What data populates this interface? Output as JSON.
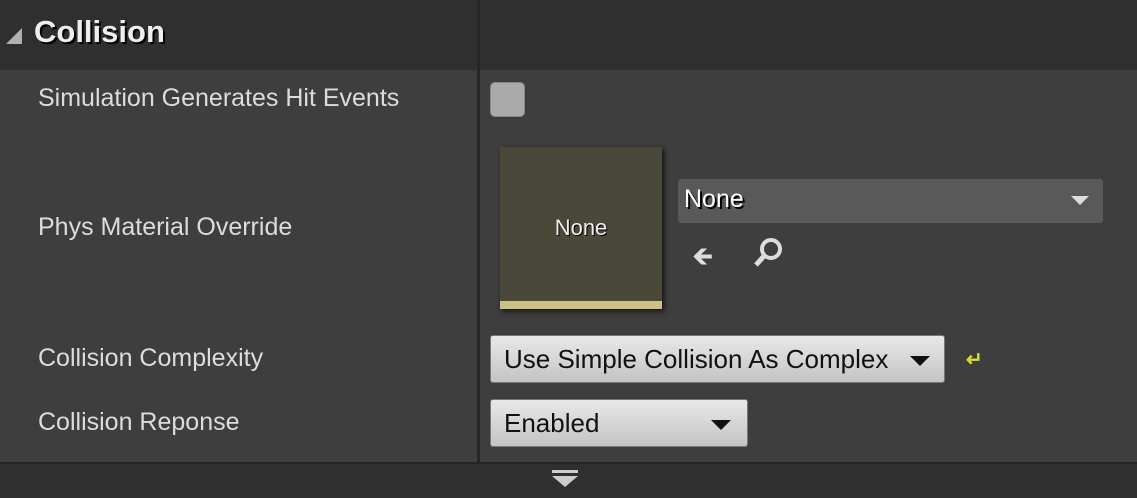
{
  "section": {
    "title": "Collision",
    "expand_icon": "triangle-down-icon"
  },
  "properties": [
    {
      "label": "Simulation Generates Hit Events",
      "checked": false
    },
    {
      "label": "Phys Material Override",
      "thumbnail_text": "None",
      "value": "None",
      "icons": [
        "use-selected-arrow-icon",
        "browse-magnifier-icon"
      ]
    },
    {
      "label": "Collision Complexity",
      "value": "Use Simple Collision As Complex",
      "reset_icon": "reset-to-default-icon"
    },
    {
      "label": "Collision Reponse",
      "value": "Enabled"
    }
  ],
  "footer": {
    "icon": "expand-advanced-icon"
  },
  "colors": {
    "thumbnail_bar": "#c9c283",
    "reset": "#d4e022"
  }
}
